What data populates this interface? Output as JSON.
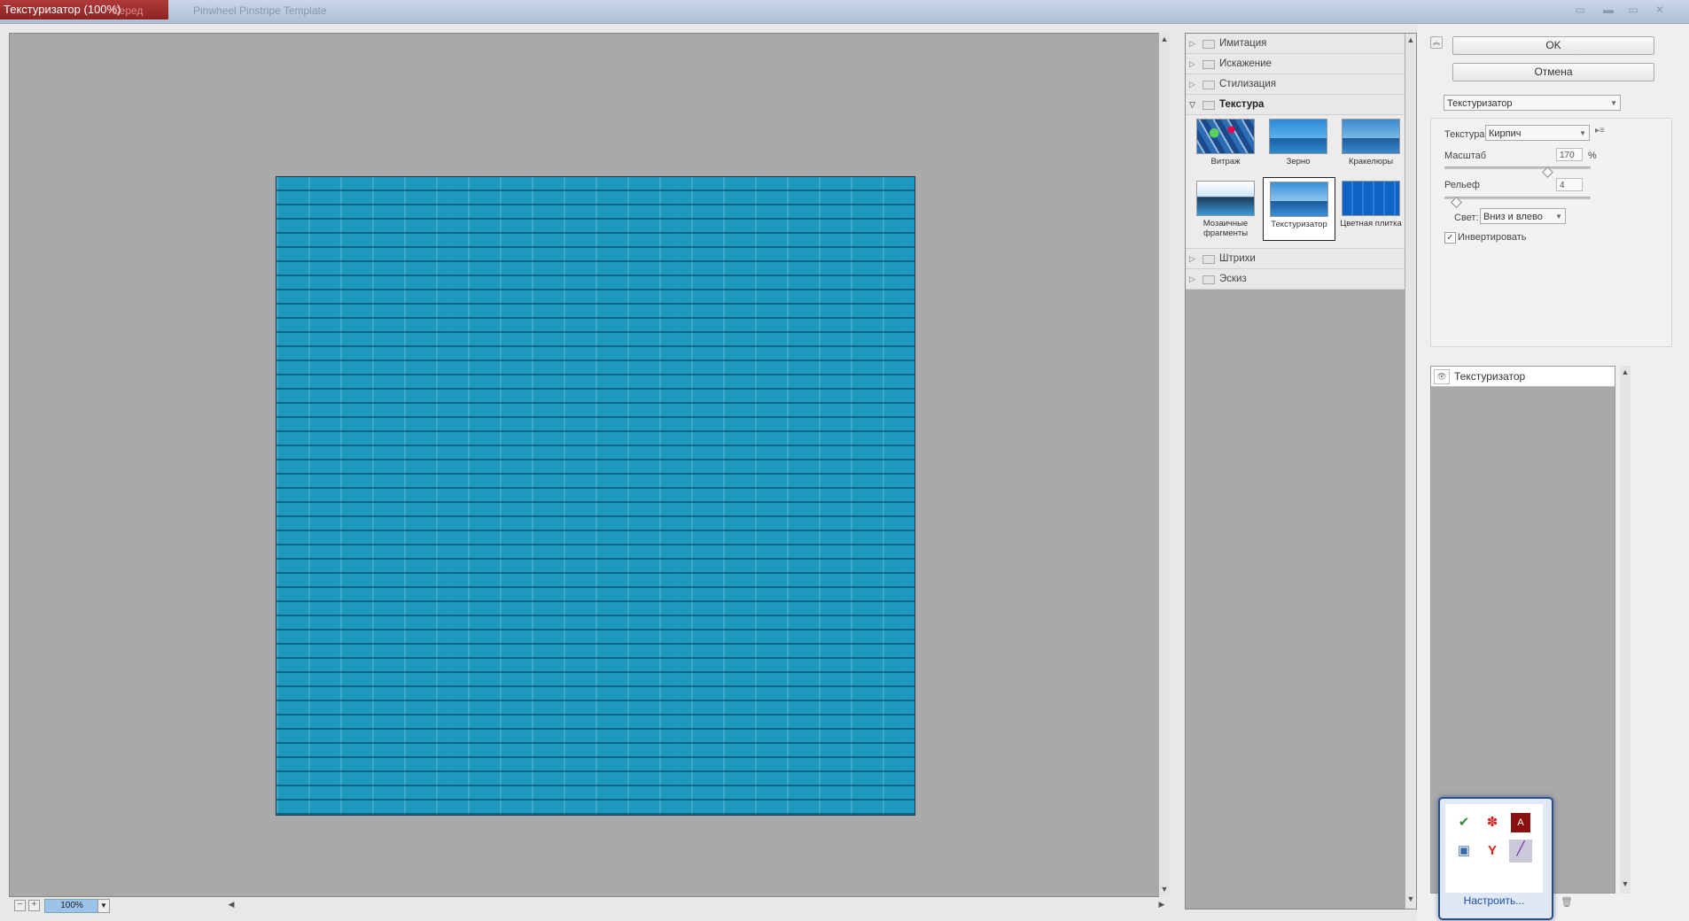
{
  "window": {
    "title": "Текстуризатор (100%)",
    "ghost_tab_1": "Серед",
    "ghost_tab_2": "Pinwheel Pinstripe Template",
    "ctrl_icons": [
      "tile-icon",
      "minimize-icon",
      "restore-icon",
      "close-icon"
    ]
  },
  "preview": {
    "zoom": "100%",
    "zoom_out": "−",
    "zoom_in": "+",
    "canvas_color": "#1e98bd",
    "workspace_color": "#a9a9a9"
  },
  "gallery": {
    "categories_top": [
      "Имитация",
      "Искажение",
      "Стилизация"
    ],
    "open_category": "Текстура",
    "filters": [
      {
        "label": "Витраж",
        "selected": false
      },
      {
        "label": "Зерно",
        "selected": false
      },
      {
        "label": "Кракелюры",
        "selected": false
      },
      {
        "label": "Мозаичные фрагменты",
        "selected": false
      },
      {
        "label": "Текстуризатор",
        "selected": true
      },
      {
        "label": "Цветная плитка",
        "selected": false
      }
    ],
    "categories_bottom": [
      "Штрихи",
      "Эскиз"
    ]
  },
  "side": {
    "ok_label": "OK",
    "cancel_label": "Отмена",
    "filter_select": "Текстуризатор",
    "texture_label": "Текстура:",
    "texture_value": "Кирпич",
    "scale_label": "Масштаб",
    "scale_value": "170",
    "scale_unit": "%",
    "scale_fraction": 0.7,
    "relief_label": "Рельеф",
    "relief_value": "4",
    "relief_fraction": 0.08,
    "light_label": "Свет:",
    "light_value": "Вниз и влево",
    "invert_label": "Инвертировать",
    "invert_checked": true
  },
  "layers": {
    "layer_name": "Текстуризатор"
  },
  "tray": {
    "icons": [
      "shield-check-icon",
      "paw-icon",
      "pdf-icon",
      "image-icon",
      "yandex-icon",
      "pen-icon"
    ],
    "configure_label": "Настроить..."
  }
}
